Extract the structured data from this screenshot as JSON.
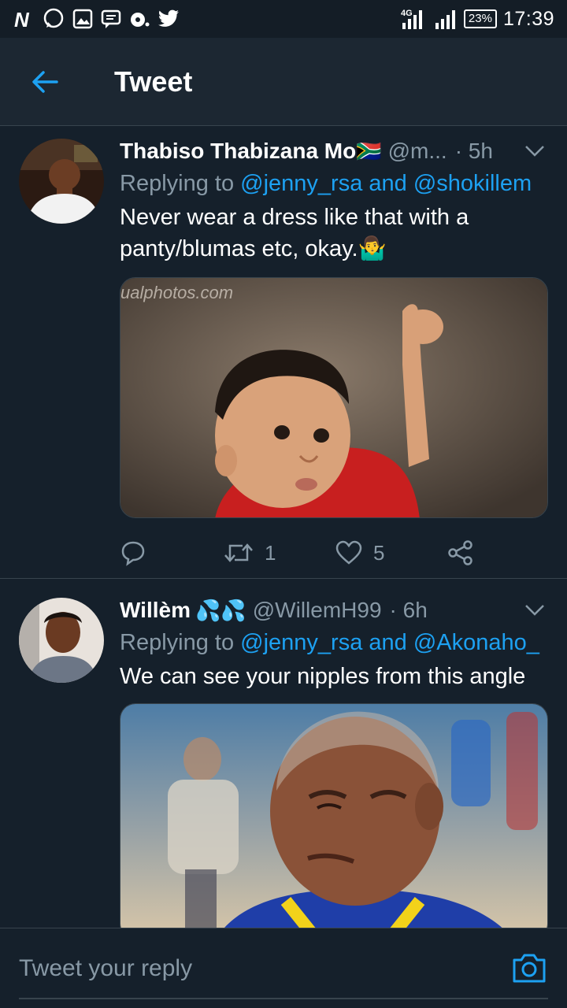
{
  "status_bar": {
    "network": "4G",
    "battery": "23%",
    "time": "17:39"
  },
  "header": {
    "title": "Tweet"
  },
  "tweets": [
    {
      "name": "Thabiso Thabizana Mo",
      "flag": "🇿🇦",
      "handle": "@m...",
      "time": "· 5h",
      "reply_prefix": "Replying to ",
      "reply_to": "@jenny_rsa and @shokillem",
      "text": "Never wear a dress like that with a panty/blumas etc, okay.🤷‍♂️",
      "watermark": "ualphotos.com",
      "retweets": "1",
      "likes": "5"
    },
    {
      "name": "Willèm",
      "emoji": "💦💦",
      "handle": "@WillemH99",
      "time": "· 6h",
      "reply_prefix": "Replying to ",
      "reply_to": "@jenny_rsa and @Akonaho_",
      "text": "We can see your nipples from this angle"
    }
  ],
  "reply_bar": {
    "placeholder": "Tweet your reply"
  },
  "colors": {
    "background": "#15202b",
    "accent": "#1da1f2",
    "muted": "#8899a6"
  }
}
